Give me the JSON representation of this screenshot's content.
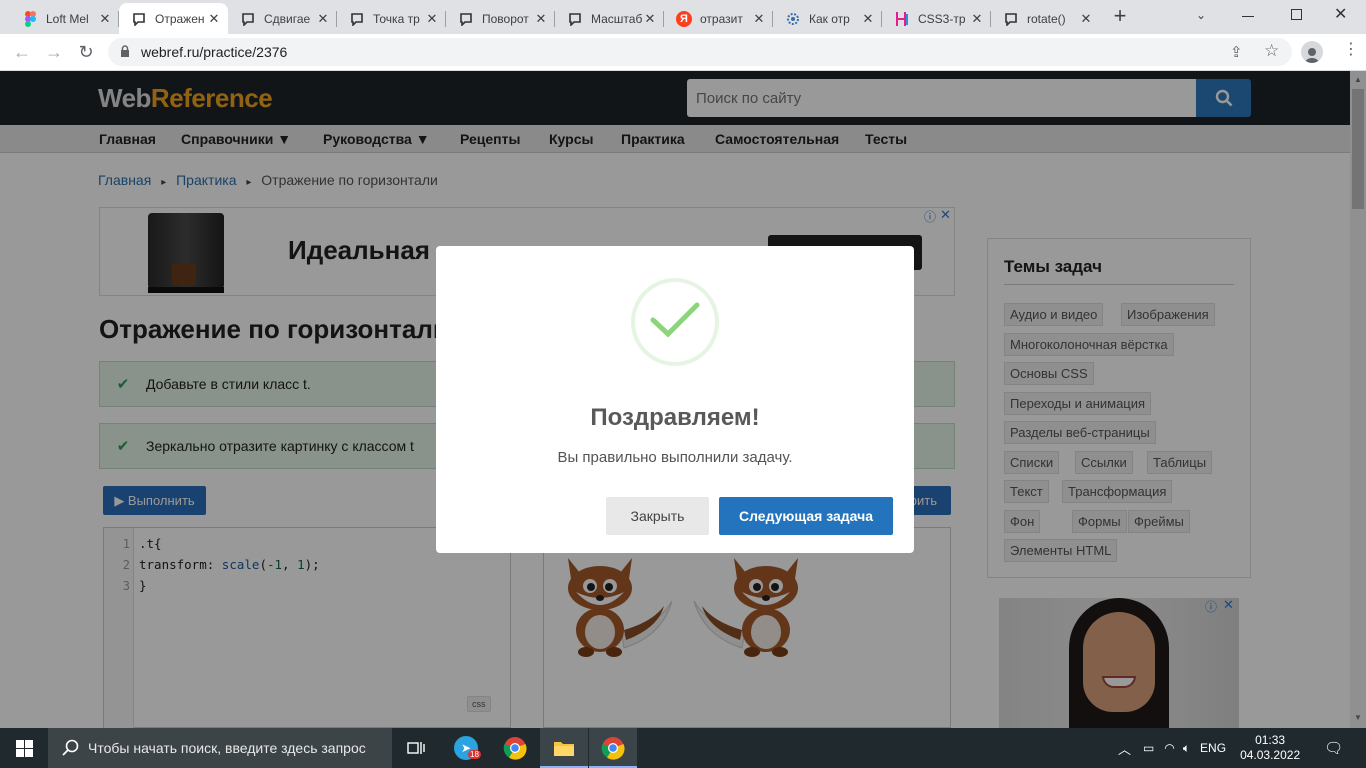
{
  "browser": {
    "tabs": [
      {
        "title": "Loft Mel",
        "icon": "figma-icon"
      },
      {
        "title": "Отражен",
        "icon": "comment-icon",
        "active": true
      },
      {
        "title": "Сдвигае",
        "icon": "comment-icon"
      },
      {
        "title": "Точка тр",
        "icon": "comment-icon"
      },
      {
        "title": "Поворот",
        "icon": "comment-icon"
      },
      {
        "title": "Масштаб",
        "icon": "comment-icon"
      },
      {
        "title": "отразит",
        "icon": "yandex-icon"
      },
      {
        "title": "Как отр",
        "icon": "gear-icon"
      },
      {
        "title": "CSS3-тр",
        "icon": "htmlbook-icon"
      },
      {
        "title": "rotate()",
        "icon": "comment-icon"
      }
    ],
    "new_tab": "+",
    "url": "webref.ru/practice/2376"
  },
  "site": {
    "logo_part1": "Web",
    "logo_part2": "Reference",
    "search_placeholder": "Поиск по сайту",
    "nav": [
      "Главная",
      "Справочники ▼",
      "Руководства ▼",
      "Рецепты",
      "Курсы",
      "Практика",
      "Самостоятельная",
      "Тесты"
    ],
    "breadcrumb": {
      "home": "Главная",
      "section": "Практика",
      "current": "Отражение по горизонтали",
      "sep": "▸"
    },
    "ad_text": "Идеальная",
    "page_title": "Отражение по горизонтали",
    "tasks": [
      "Добавьте в стили класс t.",
      "Зеркально отразите картинку с классом t"
    ],
    "run_label": "▶ Выполнить",
    "reset_label": "рить",
    "code": {
      "line_numbers": [
        "1",
        "2",
        "3"
      ],
      "line1": ".t{",
      "line2_prop": "transform: ",
      "line2_fn": "scale",
      "line2_open": "(",
      "line2_a": "-1",
      "line2_comma": ", ",
      "line2_b": "1",
      "line2_close": ");",
      "line3": "}",
      "lang": "css"
    },
    "sidebar": {
      "title": "Темы задач",
      "tags": [
        "Аудио и видео",
        "Изображения",
        "Многоколоночная вёрстка",
        "Основы CSS",
        "Переходы и анимация",
        "Разделы веб-страницы",
        "Списки",
        "Ссылки",
        "Таблицы",
        "Текст",
        "Трансформация",
        "Фон",
        "Формы",
        "Фреймы",
        "Элементы HTML"
      ]
    }
  },
  "modal": {
    "title": "Поздравляем!",
    "text": "Вы правильно выполнили задачу.",
    "close_label": "Закрыть",
    "next_label": "Следующая задача"
  },
  "taskbar": {
    "search_placeholder": "Чтобы начать поиск, введите здесь запрос",
    "telegram_badge": "18",
    "lang": "ENG",
    "time": "01:33",
    "date": "04.03.2022"
  }
}
